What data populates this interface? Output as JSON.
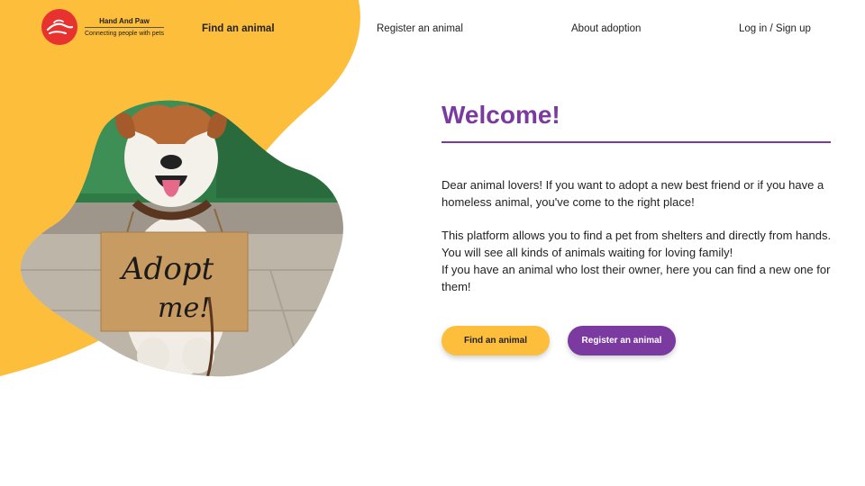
{
  "brand": {
    "name": "Hand And Paw",
    "tagline": "Connecting people with pets",
    "logo_icon": "hand-paw-icon",
    "color_primary": "#7b3aa0",
    "color_accent": "#fdbe3b",
    "color_logo": "#e8322f"
  },
  "nav": {
    "find": "Find an animal",
    "register": "Register an animal",
    "about": "About adoption",
    "login": "Log in / Sign up"
  },
  "hero": {
    "sign_line1": "Adopt",
    "sign_line2": "me!"
  },
  "content": {
    "title": "Welcome!",
    "paragraph1": "Dear animal lovers! If you want to adopt a new best friend or if you have a homeless animal, you've come to the right place!",
    "paragraph2": "This platform allows you to find a pet from shelters and directly from hands. You will see all kinds of animals waiting for loving family!",
    "paragraph3": "If you have an animal who lost their owner, here you can find a new one for them!"
  },
  "buttons": {
    "find": "Find an animal",
    "register": "Register an animal"
  }
}
